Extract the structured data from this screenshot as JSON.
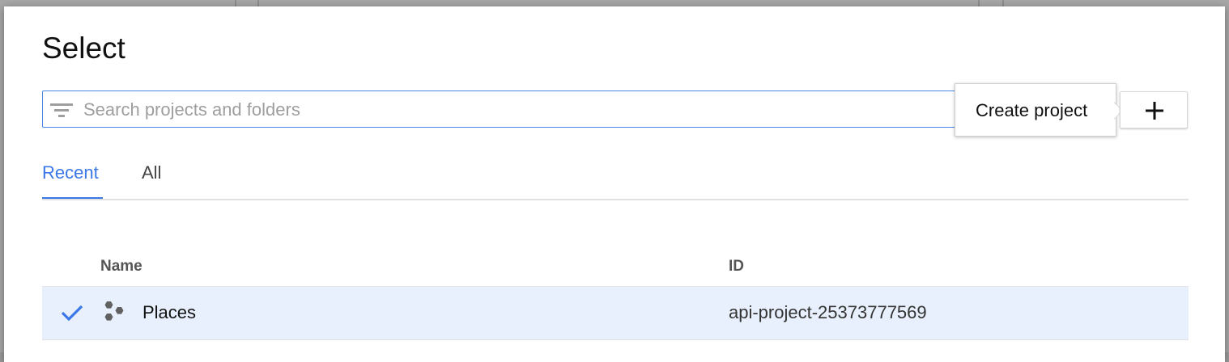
{
  "dialog": {
    "title": "Select"
  },
  "search": {
    "placeholder": "Search projects and folders",
    "value": "",
    "icon": "filter-icon"
  },
  "create_project": {
    "tooltip_label": "Create project",
    "button_icon": "plus-icon"
  },
  "tabs": [
    {
      "label": "Recent",
      "active": true
    },
    {
      "label": "All",
      "active": false
    }
  ],
  "table": {
    "columns": [
      "Name",
      "ID"
    ],
    "rows": [
      {
        "selected": true,
        "name": "Places",
        "id": "api-project-25373777569",
        "icon": "project-hexagons-icon"
      }
    ]
  },
  "colors": {
    "accent": "#3b78e7",
    "selected_row": "#e8f0fe"
  }
}
